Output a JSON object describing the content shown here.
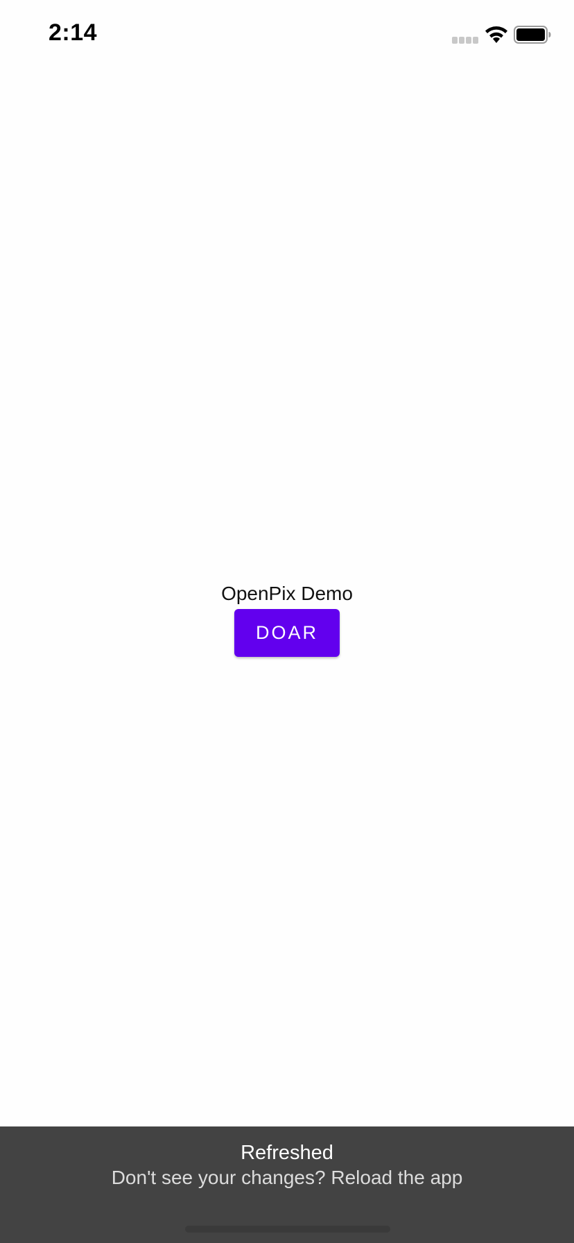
{
  "status_bar": {
    "time": "2:14",
    "signal_icon": "cellular-signal-icon",
    "wifi_icon": "wifi-icon",
    "battery_icon": "battery-icon"
  },
  "main": {
    "title": "OpenPix Demo",
    "donate_label": "DOAR",
    "accent_color": "#6200ee"
  },
  "toast": {
    "title": "Refreshed",
    "message": "Don't see your changes? Reload the app",
    "background_color": "#434343"
  }
}
